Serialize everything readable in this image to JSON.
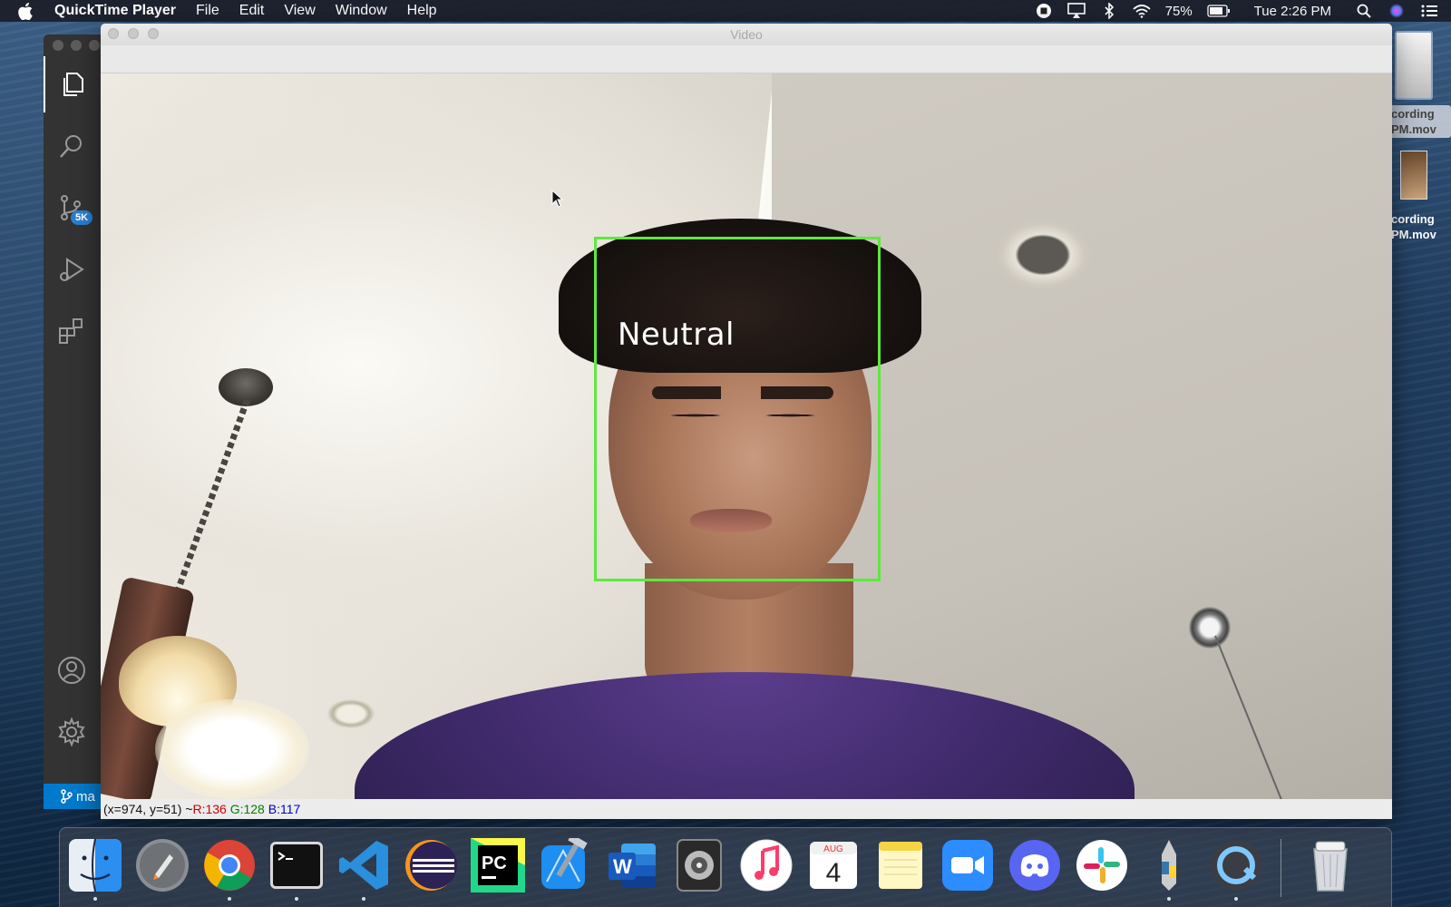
{
  "menubar": {
    "app_name": "QuickTime Player",
    "menus": [
      "File",
      "Edit",
      "View",
      "Window",
      "Help"
    ],
    "battery": "75%",
    "clock": "Tue 2:26 PM"
  },
  "desktop": {
    "files": [
      "cording\nPM.mov",
      "cording\nPM.mov"
    ]
  },
  "vscode": {
    "source_control_badge": "5K",
    "branch": "ma"
  },
  "video_window": {
    "title": "Video",
    "detection_label": "Neutral",
    "status": {
      "coords": "(x=974, y=51) ~ ",
      "r": "R:136",
      "g": "G:128",
      "b": "B:117"
    }
  },
  "dock": {
    "calendar_month": "AUG",
    "calendar_day": "4",
    "apps": [
      "finder-icon",
      "launchpad-icon",
      "chrome-icon",
      "terminal-icon",
      "vscode-icon",
      "eclipse-icon",
      "pycharm-icon",
      "xcode-icon",
      "word-icon",
      "logic-icon",
      "music-icon",
      "calendar-icon",
      "notes-icon",
      "zoom-icon",
      "discord-icon",
      "slack-icon",
      "python-launcher-icon",
      "quicktime-icon",
      "trash-icon"
    ]
  },
  "colors": {
    "face_box": "#5ee83f",
    "vscode_accent": "#007acc"
  }
}
